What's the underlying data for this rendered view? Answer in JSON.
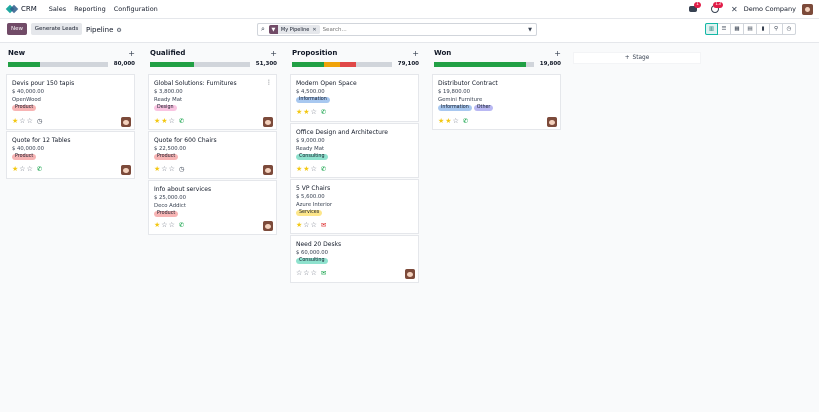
{
  "app": {
    "name": "CRM"
  },
  "nav": {
    "menu": [
      "Sales",
      "Reporting",
      "Configuration"
    ],
    "chat_count": "1",
    "activity_count": "13",
    "company": "Demo Company"
  },
  "control": {
    "new_label": "New",
    "generate_label": "Generate Leads",
    "breadcrumb": "Pipeline",
    "facet": "My Pipeline",
    "search_placeholder": "Search..."
  },
  "columns": [
    {
      "title": "New",
      "total": "80,000",
      "cards": [
        {
          "title": "Devis pour 150 tapis",
          "amount": "$ 40,000.00",
          "customer": "OpenWood",
          "tags": [
            "Product"
          ],
          "stars": 1,
          "activity": "clock"
        },
        {
          "title": "Quote for 12 Tables",
          "amount": "$ 40,000.00",
          "customer": "",
          "tags": [
            "Product"
          ],
          "stars": 1,
          "activity": "phone"
        }
      ]
    },
    {
      "title": "Qualified",
      "total": "51,300",
      "cards": [
        {
          "title": "Global Solutions: Furnitures",
          "amount": "$ 3,800.00",
          "customer": "Ready Mat",
          "tags": [
            "Design"
          ],
          "stars": 2,
          "activity": "phone"
        },
        {
          "title": "Quote for 600 Chairs",
          "amount": "$ 22,500.00",
          "customer": "",
          "tags": [
            "Product"
          ],
          "stars": 1,
          "activity": "clock"
        },
        {
          "title": "Info about services",
          "amount": "$ 25,000.00",
          "customer": "Deco Addict",
          "tags": [
            "Product"
          ],
          "stars": 1,
          "activity": "phone"
        }
      ]
    },
    {
      "title": "Proposition",
      "total": "79,100",
      "cards": [
        {
          "title": "Modern Open Space",
          "amount": "$ 4,500.00",
          "customer": "",
          "tags": [
            "Information"
          ],
          "stars": 2,
          "activity": "phone"
        },
        {
          "title": "Office Design and Architecture",
          "amount": "$ 9,000.00",
          "customer": "Ready Mat",
          "tags": [
            "Consulting"
          ],
          "stars": 2,
          "activity": "phone"
        },
        {
          "title": "5 VP Chairs",
          "amount": "$ 5,600.00",
          "customer": "Azure Interior",
          "tags": [
            "Services"
          ],
          "stars": 1,
          "activity": "mail"
        },
        {
          "title": "Need 20 Desks",
          "amount": "$ 60,000.00",
          "customer": "",
          "tags": [
            "Consulting"
          ],
          "stars": 0,
          "activity": "mail-green"
        }
      ]
    },
    {
      "title": "Won",
      "total": "19,800",
      "cards": [
        {
          "title": "Distributor Contract",
          "amount": "$ 19,800.00",
          "customer": "Gemini Furniture",
          "tags": [
            "Information",
            "Other"
          ],
          "stars": 2,
          "activity": "phone"
        }
      ]
    }
  ],
  "stage_button": "Stage",
  "colors": {
    "primary": "#714b67",
    "Product": "#f7b4b4",
    "Design": "#f9c4e1",
    "Information": "#a8c8f0",
    "Other": "#b9b8f3",
    "Consulting": "#8fe2ce",
    "Services": "#fde68a"
  }
}
